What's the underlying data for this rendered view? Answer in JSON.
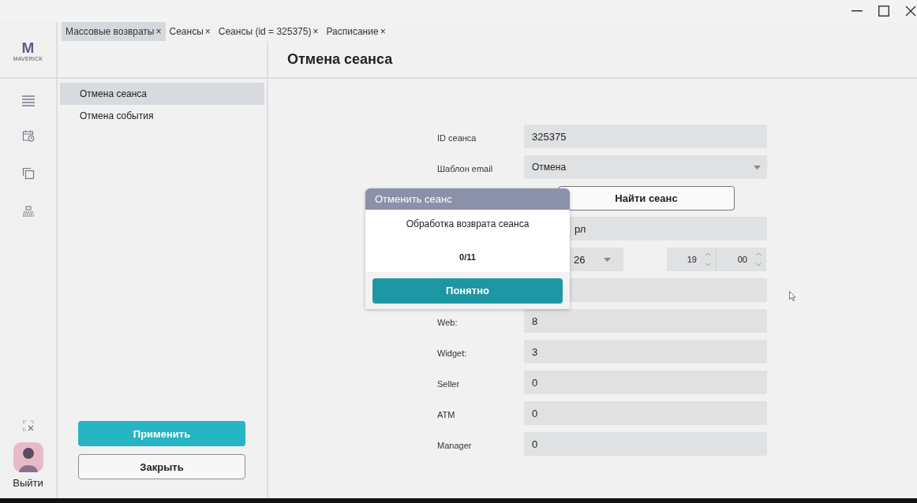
{
  "logo": {
    "mark": "M",
    "text": "MAVERICK"
  },
  "tabs": [
    {
      "label": "Массовые возвраты",
      "close": "×",
      "selected": true
    },
    {
      "label": "Сеансы",
      "close": "×",
      "selected": false
    },
    {
      "label": "Сеансы (id = 325375)",
      "close": "×",
      "selected": false
    },
    {
      "label": "Расписание",
      "close": "×",
      "selected": false
    }
  ],
  "sidebar": {
    "items": [
      {
        "label": "Отмена сеанса",
        "selected": true
      },
      {
        "label": "Отмена события",
        "selected": false
      }
    ],
    "buttons": [
      {
        "label": "Применить",
        "kind": "primary"
      },
      {
        "label": "Закрыть",
        "kind": "secondary"
      }
    ]
  },
  "logout": "Выйти",
  "page": {
    "title": "Отмена сеанса"
  },
  "form": {
    "rows": [
      {
        "kind": "text",
        "label": "ID сеанса",
        "value": "325375"
      },
      {
        "kind": "select",
        "label": "Шаблон email",
        "value": "Отмена"
      },
      {
        "kind": "button",
        "label": "Найти сеанс"
      },
      {
        "kind": "text",
        "value": "рл",
        "covered": true
      },
      {
        "kind": "datetime",
        "date": "26",
        "hour": "19",
        "minute": "00"
      },
      {
        "kind": "text"
      },
      {
        "kind": "text",
        "label": "Web:",
        "value": "8"
      },
      {
        "kind": "text",
        "label": "Widget:",
        "value": "3"
      },
      {
        "kind": "text",
        "label": "Seller",
        "value": "0"
      },
      {
        "kind": "text",
        "label": "ATM",
        "value": "0"
      },
      {
        "kind": "text",
        "label": "Manager",
        "value": "0"
      }
    ]
  },
  "dialog": {
    "title": "Отменить сеанс",
    "message": "Обработка возврата сеанса",
    "progress": "0/11",
    "button": "Понятно"
  }
}
